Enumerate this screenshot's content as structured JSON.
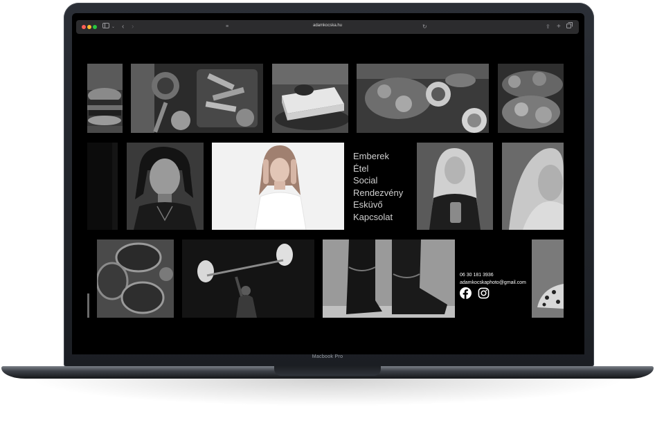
{
  "device": {
    "label": "Macbook Pro"
  },
  "browser": {
    "url": "adamkocska.hu",
    "icons": [
      "sidebar-icon",
      "chevron-down-icon",
      "back-icon",
      "forward-icon",
      "reader-icon",
      "reload-icon",
      "share-icon",
      "new-tab-icon",
      "tabs-icon"
    ]
  },
  "nav": {
    "items": [
      "Emberek",
      "Étel",
      "Social",
      "Rendezvény",
      "Esküvő",
      "Kapcsolat"
    ]
  },
  "contact": {
    "phone": "06 30 181 3936",
    "email": "adamkocskaphoto@gmail.com"
  },
  "social": [
    "facebook-icon",
    "instagram-icon"
  ],
  "colors": {
    "page_bg": "#000000",
    "menu_text": "#cfcfcf",
    "close": "#ff5f57",
    "minimize": "#febc2e",
    "zoom": "#28c840"
  }
}
